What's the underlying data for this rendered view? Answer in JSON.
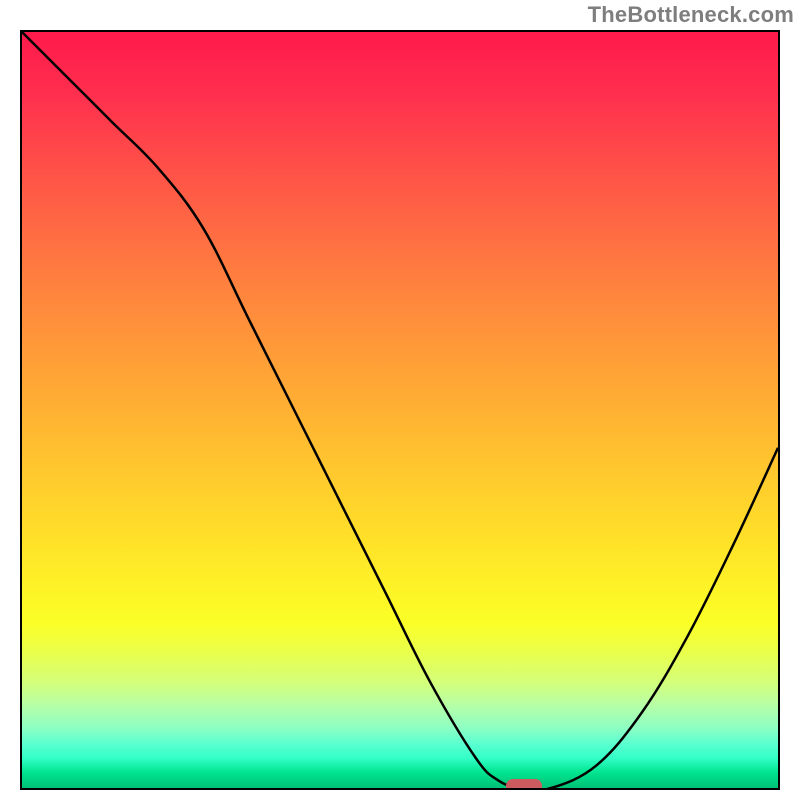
{
  "watermark": "TheBottleneck.com",
  "colors": {
    "border": "#000000",
    "curve": "#000000",
    "marker": "#cc5b60",
    "gradient_top": "#ff1a4b",
    "gradient_bottom": "#00c176"
  },
  "chart_data": {
    "type": "line",
    "title": "",
    "xlabel": "",
    "ylabel": "",
    "xlim": [
      0,
      100
    ],
    "ylim": [
      0,
      100
    ],
    "grid": false,
    "legend": false,
    "x": [
      0,
      6,
      12,
      18,
      24,
      30,
      36,
      42,
      48,
      54,
      60,
      63,
      66,
      70,
      76,
      82,
      88,
      94,
      100
    ],
    "values": [
      100,
      94,
      88,
      82,
      74,
      62,
      50,
      38,
      26,
      14,
      4,
      1,
      0,
      0,
      3,
      10,
      20,
      32,
      45
    ],
    "marker": {
      "x": 66,
      "y": 0
    },
    "notes": "V-shaped bottleneck curve on vertical rainbow gradient; y=0 is optimal (green), y=100 is worst (red). Small rounded marker sits at the curve minimum near x≈66."
  }
}
